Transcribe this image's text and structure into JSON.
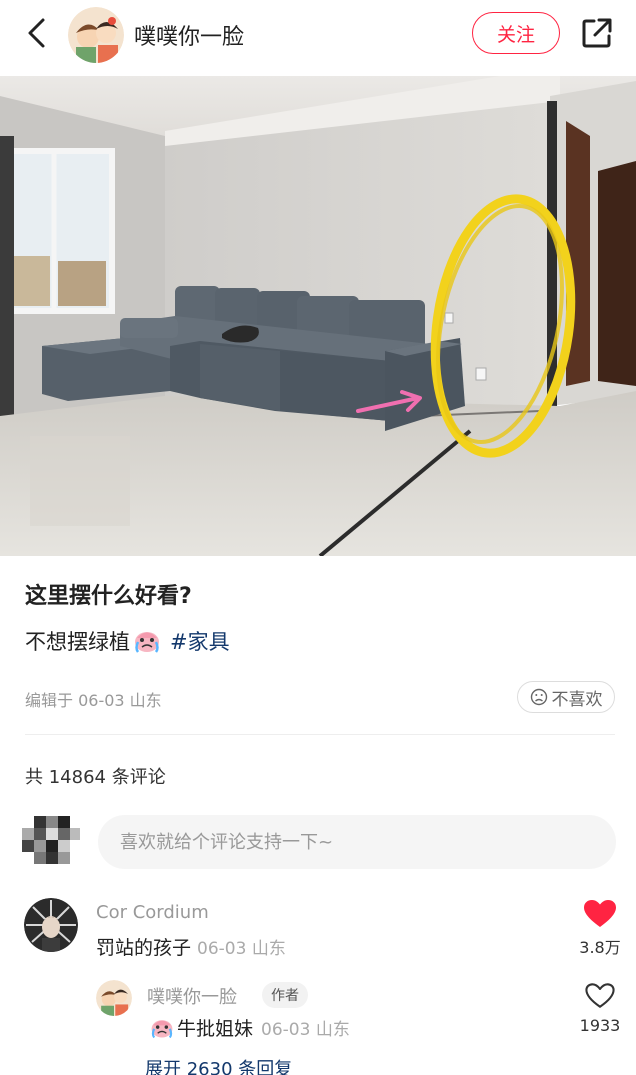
{
  "header": {
    "author_name": "噗噗你一脸",
    "follow_label": "关注"
  },
  "post": {
    "title": "这里摆什么好看?",
    "desc_text": "不想摆绿植",
    "hashtag": "#家具",
    "edit_info": "编辑于 06-03 山东",
    "dislike_label": "不喜欢"
  },
  "comments": {
    "count_text": "共 14864 条评论",
    "input_placeholder": "喜欢就给个评论支持一下~",
    "items": [
      {
        "user": "Cor Cordium",
        "text": "罚站的孩子",
        "meta": "06-03 山东",
        "likes": "3.8万",
        "liked": true,
        "replies": [
          {
            "user": "噗噗你一脸",
            "tag": "作者",
            "text": "牛批姐妹",
            "meta": "06-03 山东",
            "likes": "1933"
          }
        ],
        "expand_text": "展开 2630 条回复"
      }
    ]
  },
  "colors": {
    "accent": "#ff2442",
    "link": "#13386c",
    "highlight_circle": "#f2d21c",
    "arrow": "#f06fb0"
  }
}
